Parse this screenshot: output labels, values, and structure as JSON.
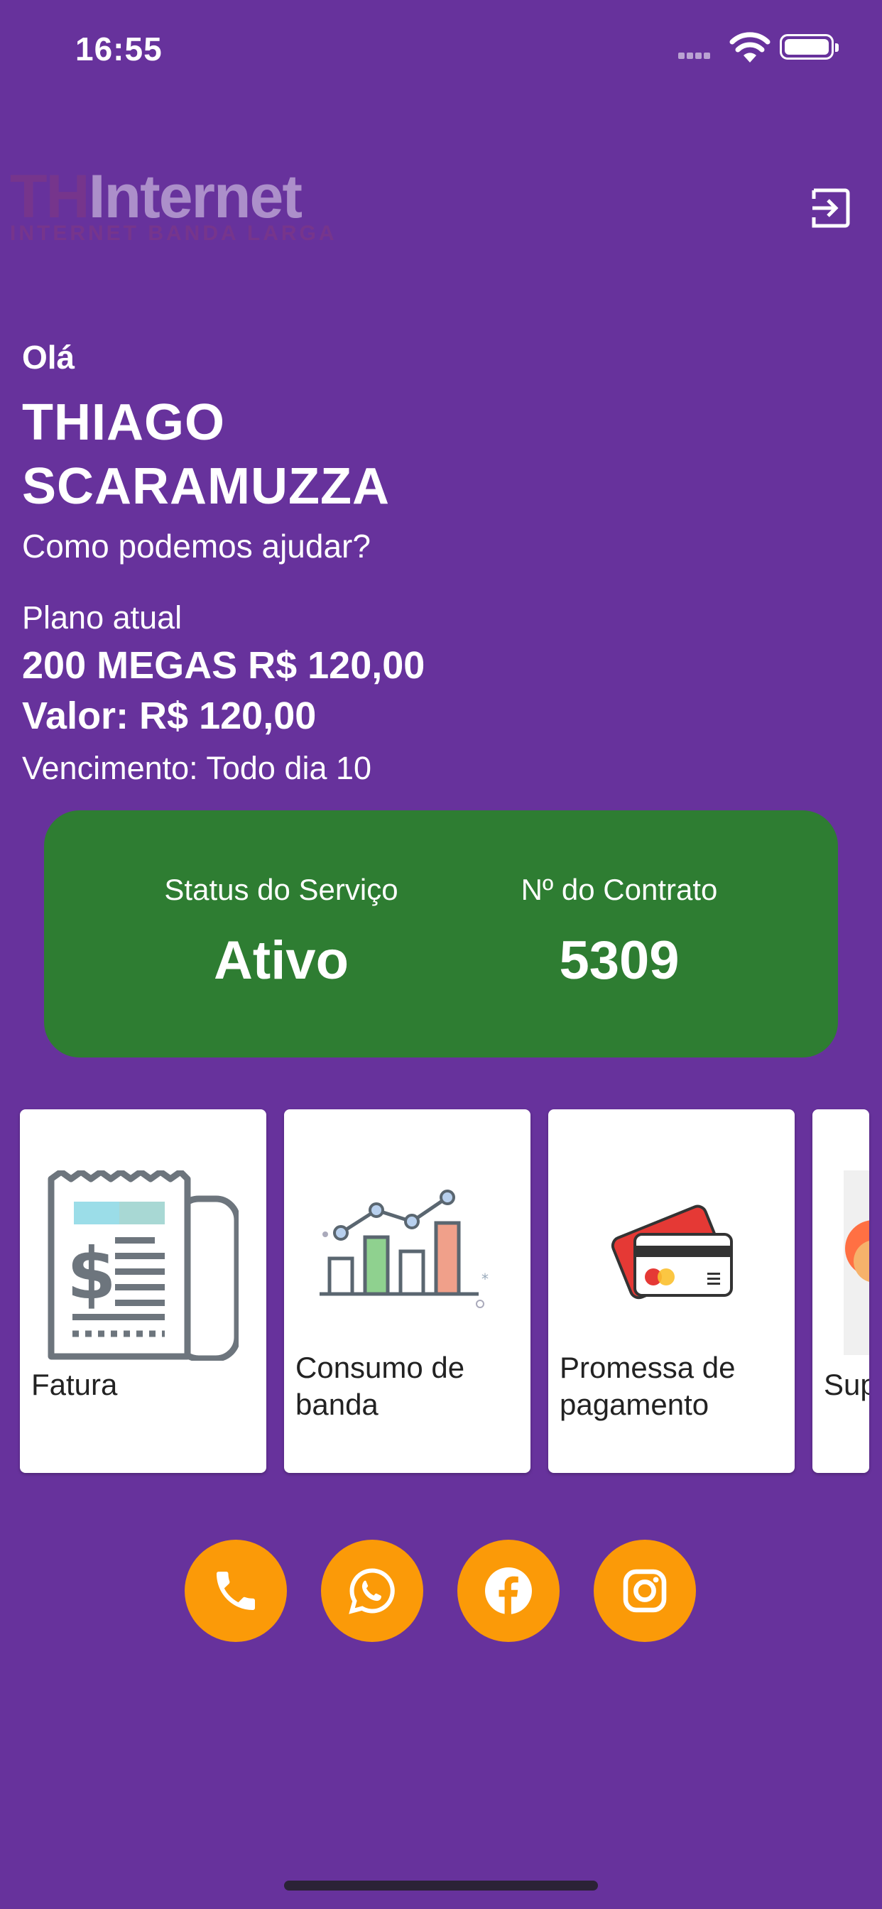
{
  "status_bar": {
    "time": "16:55"
  },
  "header": {
    "logo_brand_prefix": "TH",
    "logo_brand_name": "Internet",
    "logo_tagline": "INTERNET BANDA LARGA",
    "logout_icon": "logout-icon"
  },
  "greeting": {
    "hello": "Olá",
    "name": "THIAGO SCARAMUZZA",
    "question": "Como podemos ajudar?"
  },
  "plan": {
    "label": "Plano atual",
    "name": "200 MEGAS R$ 120,00",
    "value": "Valor: R$ 120,00",
    "due": "Vencimento: Todo dia 10"
  },
  "status_card": {
    "color": "#2e7d32",
    "service_label": "Status do Serviço",
    "service_value": "Ativo",
    "contract_label": "Nº do Contrato",
    "contract_value": "5309"
  },
  "menu": [
    {
      "label": "Fatura",
      "icon": "invoice-icon"
    },
    {
      "label": "Consumo de banda",
      "icon": "bandwidth-chart-icon"
    },
    {
      "label": "Promessa de pagamento",
      "icon": "credit-card-icon"
    },
    {
      "label": "Sup",
      "icon": "support-agent-icon"
    }
  ],
  "social": [
    {
      "name": "phone",
      "icon": "phone-icon"
    },
    {
      "name": "whatsapp",
      "icon": "whatsapp-icon"
    },
    {
      "name": "facebook",
      "icon": "facebook-icon"
    },
    {
      "name": "instagram",
      "icon": "instagram-icon"
    }
  ],
  "colors": {
    "background": "#67329c",
    "accent": "#fb9a08",
    "status_card": "#2e7d32"
  }
}
